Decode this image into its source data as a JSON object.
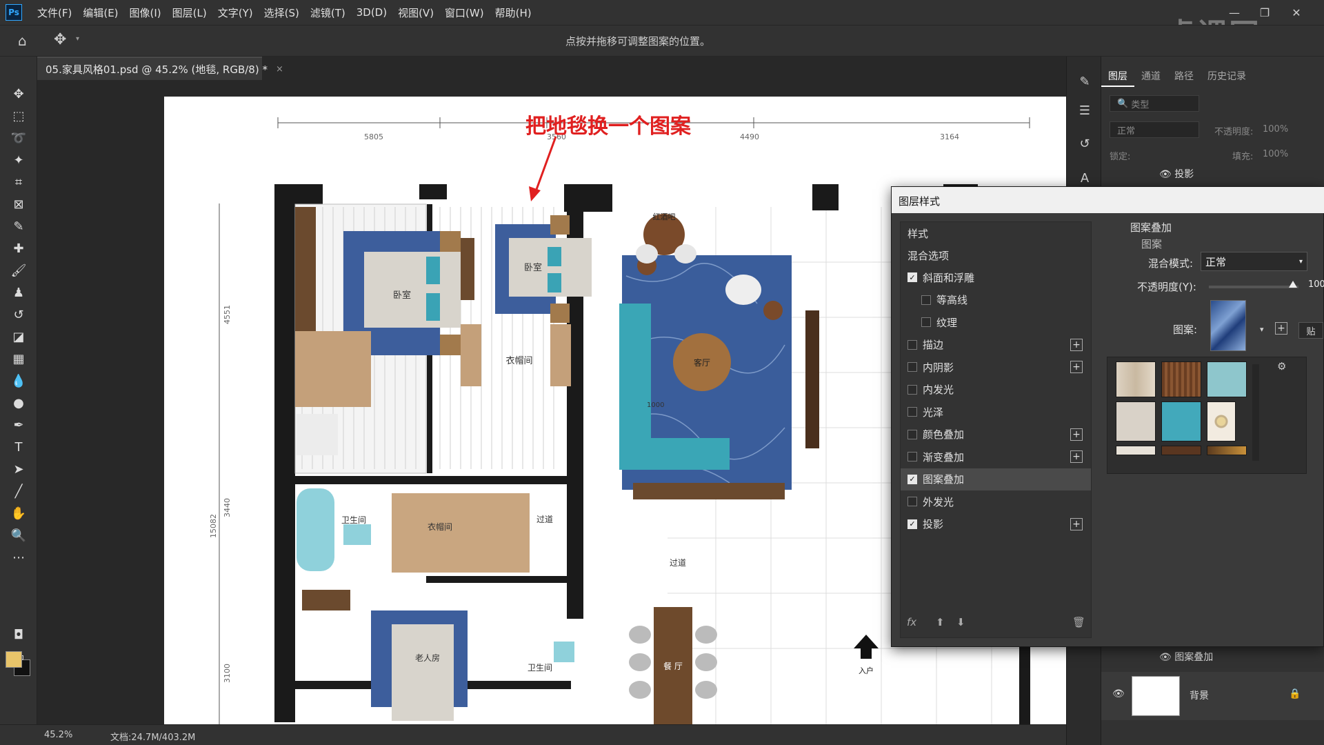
{
  "app": {
    "logo": "Ps",
    "menu": [
      "文件(F)",
      "编辑(E)",
      "图像(I)",
      "图层(L)",
      "文字(Y)",
      "选择(S)",
      "滤镜(T)",
      "3D(D)",
      "视图(V)",
      "窗口(W)",
      "帮助(H)"
    ],
    "window_controls": [
      "minimize-icon",
      "restore-icon",
      "close-icon"
    ],
    "watermark": "虎课网"
  },
  "options_bar": {
    "hint": "点按并拖移可调整图案的位置。",
    "icons": [
      "home-icon",
      "move-icon"
    ]
  },
  "document": {
    "tab_title": "05.家具风格01.psd @ 45.2% (地毯, RGB/8) *",
    "close": "×",
    "annotation": "把地毯换一个图案",
    "plan_labels": {
      "bedroom1": "卧室",
      "bedroom2": "卧室",
      "closet1": "衣帽间",
      "living": "客厅",
      "bar": "红酒吧",
      "bath": "卫生间",
      "closet2": "衣帽间",
      "corridor1": "过道",
      "corridor2": "过道",
      "elder_room": "老人房",
      "bath2": "卫生间",
      "dining": "餐 厅",
      "entrance": "入户",
      "dim1": "5805",
      "dim2": "3560",
      "dim3": "4490",
      "dim4": "3164",
      "dim_v1": "4551",
      "dim_v2": "3440",
      "dim_v3": "15082",
      "dim_v4": "3100",
      "dim_sofa": "1000"
    }
  },
  "status_bar": {
    "zoom": "45.2%",
    "doc_size": "文档:24.7M/403.2M"
  },
  "layers_panel": {
    "tabs": [
      "图层",
      "通道",
      "路径",
      "历史记录"
    ],
    "active_tab": "图层",
    "filter_placeholder": "类型",
    "blend_mode": "正常",
    "opacity_label": "不透明度:",
    "opacity_value": "100%",
    "lock_label": "锁定:",
    "fill_label": "填充:",
    "fill_value": "100%",
    "effect_top": "投影",
    "effect_bottom": "图案叠加",
    "background_layer": "背景"
  },
  "layer_style_dialog": {
    "title": "图层样式",
    "list_header": "样式",
    "blend_options": "混合选项",
    "styles": [
      {
        "label": "斜面和浮雕",
        "checked": true,
        "plus": false,
        "indent": false
      },
      {
        "label": "等高线",
        "checked": false,
        "plus": false,
        "indent": true
      },
      {
        "label": "纹理",
        "checked": false,
        "plus": false,
        "indent": true
      },
      {
        "label": "描边",
        "checked": false,
        "plus": true,
        "indent": false
      },
      {
        "label": "内阴影",
        "checked": false,
        "plus": true,
        "indent": false
      },
      {
        "label": "内发光",
        "checked": false,
        "plus": false,
        "indent": false
      },
      {
        "label": "光泽",
        "checked": false,
        "plus": false,
        "indent": false
      },
      {
        "label": "颜色叠加",
        "checked": false,
        "plus": true,
        "indent": false
      },
      {
        "label": "渐变叠加",
        "checked": false,
        "plus": true,
        "indent": false
      },
      {
        "label": "图案叠加",
        "checked": true,
        "plus": false,
        "indent": false,
        "selected": true
      },
      {
        "label": "外发光",
        "checked": false,
        "plus": false,
        "indent": false
      },
      {
        "label": "投影",
        "checked": true,
        "plus": true,
        "indent": false
      }
    ],
    "footer": "fx",
    "section_title": "图案叠加",
    "section_sub": "图案",
    "blend_mode_label": "混合模式:",
    "blend_mode_value": "正常",
    "opacity_label": "不透明度(Y):",
    "opacity_value": "100",
    "pattern_label": "图案:",
    "snap_button": "贴"
  }
}
